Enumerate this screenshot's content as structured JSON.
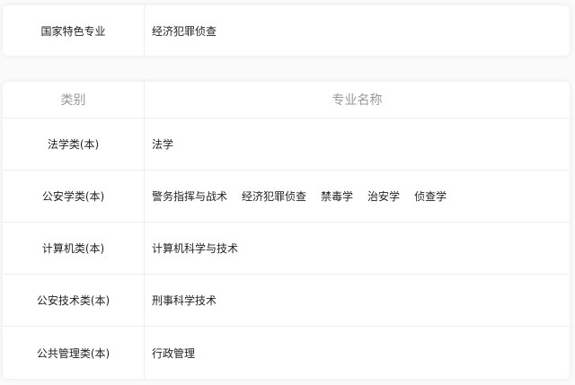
{
  "featured": {
    "label": "国家特色专业",
    "value": "经济犯罪侦查"
  },
  "table": {
    "headers": {
      "category": "类别",
      "majors": "专业名称"
    },
    "rows": [
      {
        "category": "法学类(本)",
        "majors": [
          "法学"
        ]
      },
      {
        "category": "公安学类(本)",
        "majors": [
          "警务指挥与战术",
          "经济犯罪侦查",
          "禁毒学",
          "治安学",
          "侦查学"
        ]
      },
      {
        "category": "计算机类(本)",
        "majors": [
          "计算机科学与技术"
        ]
      },
      {
        "category": "公安技术类(本)",
        "majors": [
          "刑事科学技术"
        ]
      },
      {
        "category": "公共管理类(本)",
        "majors": [
          "行政管理"
        ]
      }
    ]
  }
}
